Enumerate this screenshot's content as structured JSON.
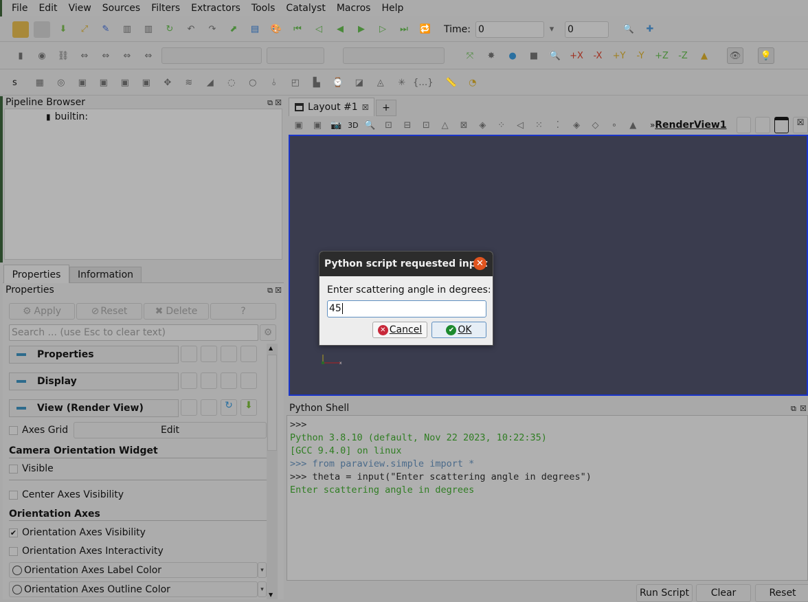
{
  "menu": [
    "File",
    "Edit",
    "View",
    "Sources",
    "Filters",
    "Extractors",
    "Tools",
    "Catalyst",
    "Macros",
    "Help"
  ],
  "time": {
    "label": "Time:",
    "value": "0",
    "step": "0"
  },
  "toolbar3": {
    "label": "s"
  },
  "view_toolbar": {
    "three_d": "3D",
    "view_name": "RenderView1",
    "overflow": "»"
  },
  "pipeline": {
    "title": "Pipeline Browser",
    "item": "builtin:"
  },
  "tabs": [
    "Properties",
    "Information"
  ],
  "layout": {
    "tab": "Layout #1",
    "add": "+"
  },
  "properties": {
    "title": "Properties",
    "apply": "Apply",
    "reset": "Reset",
    "delete": "Delete",
    "help": "?",
    "search_placeholder": "Search ... (use Esc to clear text)",
    "sections": [
      "Properties",
      "Display",
      "View (Render View)"
    ],
    "axes_grid": "Axes Grid",
    "edit": "Edit",
    "camera_widget": "Camera Orientation Widget",
    "visible": "Visible",
    "center_axes": "Center Axes Visibility",
    "orientation_axes": "Orientation Axes",
    "oa_visibility": "Orientation Axes Visibility",
    "oa_visibility_checked": true,
    "oa_interactivity": "Orientation Axes Interactivity",
    "oa_label_color": "Orientation Axes Label Color",
    "oa_outline_color": "Orientation Axes Outline Color"
  },
  "dialog": {
    "title": "Python script requested input",
    "prompt": "Enter scattering angle in degrees:",
    "value": "45",
    "cancel": "Cancel",
    "ok": "OK"
  },
  "shell": {
    "title": "Python Shell",
    "lines": [
      ">>>",
      "Python 3.8.10 (default, Nov 22 2023, 10:22:35)",
      "[GCC 9.4.0] on linux",
      ">>> from paraview.simple import *",
      ">>> theta = input(\"Enter scattering angle in degrees\")",
      "Enter scattering angle in degrees"
    ],
    "run": "Run Script",
    "clear": "Clear",
    "reset": "Reset"
  },
  "colors": {
    "render_bg": "#3a3c4e",
    "accent": "#1a35c8",
    "shell_green": "#2f7d22",
    "shell_blue": "#4a6a8a",
    "close_orange": "#e0541f"
  }
}
